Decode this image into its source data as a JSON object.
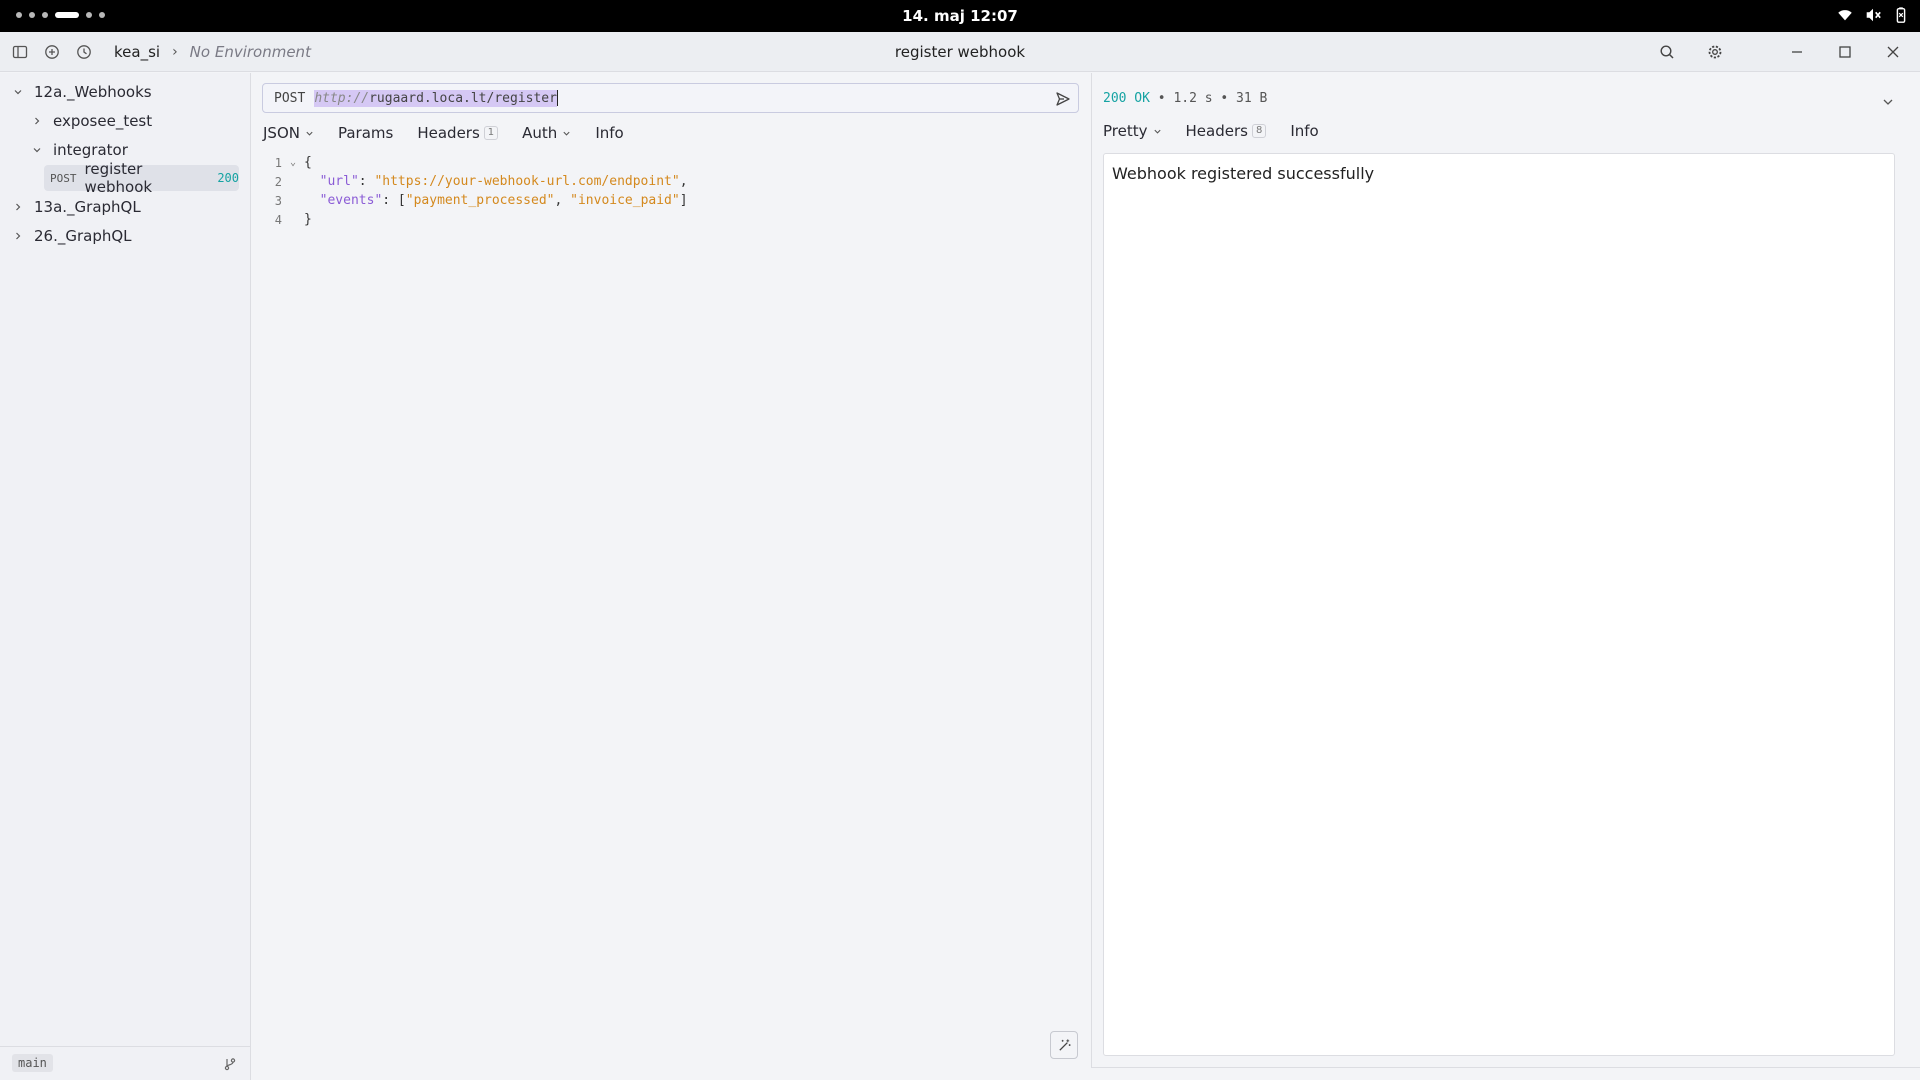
{
  "system": {
    "clock": "14. maj  12:07",
    "tray_icons": [
      "wifi-icon",
      "speaker-muted-icon",
      "battery-icon"
    ]
  },
  "titlebar": {
    "workspace": "kea_si",
    "environment": "No Environment",
    "window_title": "register webhook"
  },
  "sidebar": {
    "folder_12a": "12a._Webhooks",
    "folder_exposee": "exposee_test",
    "folder_integrator": "integrator",
    "request_method": "POST",
    "request_name": "register webhook",
    "request_status": "200",
    "folder_13a": "13a._GraphQL",
    "folder_26": "26._GraphQL",
    "branch": "main"
  },
  "request": {
    "method": "POST",
    "url_scheme": "http://",
    "url_rest": "rugaard.loca.lt/register",
    "tabs": {
      "body": "JSON",
      "params": "Params",
      "headers": "Headers",
      "headers_count": "1",
      "auth": "Auth",
      "info": "Info"
    },
    "body_lines": {
      "l1_num": "1",
      "l1_text": "{",
      "l2_num": "2",
      "l2_key": "\"url\"",
      "l2_sep": ": ",
      "l2_val": "\"https://your-webhook-url.com/endpoint\"",
      "l2_end": ",",
      "l3_num": "3",
      "l3_key": "\"events\"",
      "l3_sep": ": [",
      "l3_val1": "\"payment_processed\"",
      "l3_comma": ", ",
      "l3_val2": "\"invoice_paid\"",
      "l3_end": "]",
      "l4_num": "4",
      "l4_text": "}"
    }
  },
  "response": {
    "status_code": "200 OK",
    "meta": " • 1.2 s • 31 B",
    "tabs": {
      "pretty": "Pretty",
      "headers": "Headers",
      "headers_count": "8",
      "info": "Info"
    },
    "body": "Webhook registered successfully"
  },
  "colors": {
    "accent_teal": "#15a3a3",
    "json_key": "#8b5cd6",
    "json_string": "#d4891e",
    "selection": "#d5c8f4"
  }
}
